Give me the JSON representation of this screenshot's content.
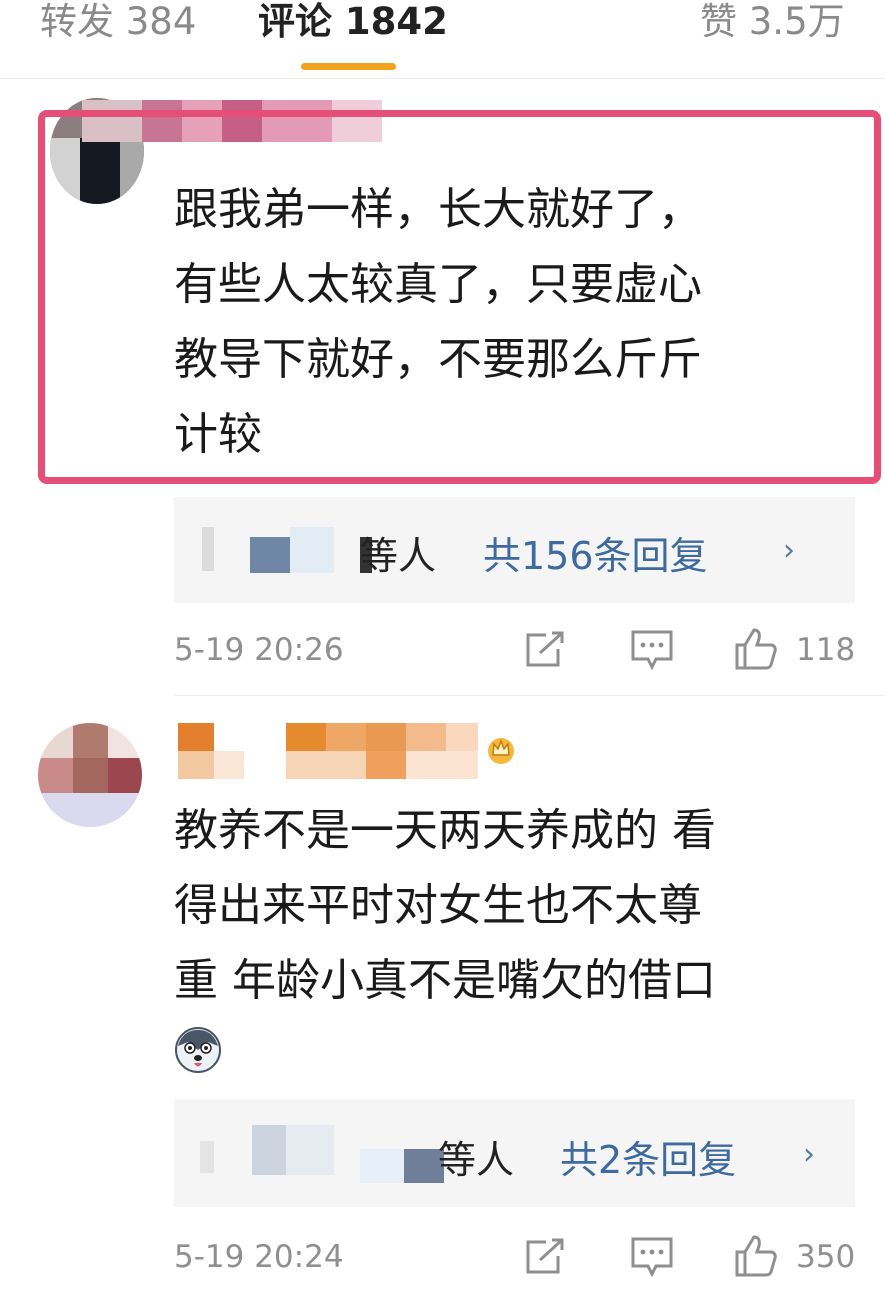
{
  "tabs": {
    "repost": "转发 384",
    "comment": "评论 1842",
    "likes": "赞 3.5万"
  },
  "colors": {
    "accent_underline": "#f2a21c",
    "highlight_border": "#e44e77",
    "link_blue": "#3e6aa0"
  },
  "comments": [
    {
      "text_lines": [
        "跟我弟一样，长大就好了，",
        "有些人太较真了，只要虚心",
        "教导下就好，不要那么斤斤",
        "计较"
      ],
      "reply_suffix": "等人",
      "reply_link": "共156条回复",
      "time": "5-19 20:26",
      "likes": "118"
    },
    {
      "text_lines": [
        "教养不是一天两天养成的 看",
        "得出来平时对女生也不太尊",
        "重  年龄小真不是嘴欠的借口"
      ],
      "reply_suffix": "等人",
      "reply_link": "共2条回复",
      "time": "5-19 20:24",
      "likes": "350"
    }
  ]
}
